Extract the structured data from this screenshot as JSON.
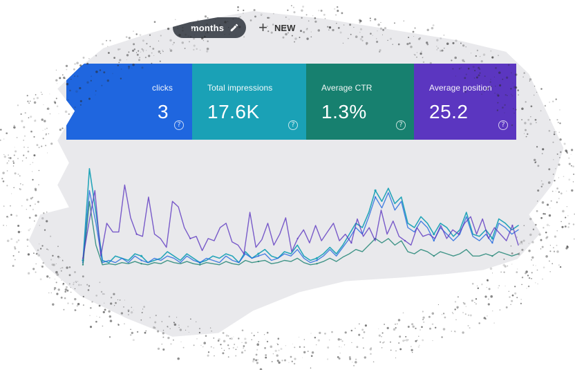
{
  "toolbar": {
    "date_chip_label": "months",
    "edit_icon": "pencil-icon",
    "new_label": "NEW",
    "plus_icon": "plus-icon"
  },
  "metrics": [
    {
      "name": "Total clicks",
      "label": "clicks",
      "value": "3",
      "color": "#1f66df"
    },
    {
      "name": "Total impressions",
      "label": "Total impressions",
      "value": "17.6K",
      "color": "#1aa1b6"
    },
    {
      "name": "Average CTR",
      "label": "Average CTR",
      "value": "1.3%",
      "color": "#17806f"
    },
    {
      "name": "Average position",
      "label": "Average position",
      "value": "25.2",
      "color": "#5b36c0"
    }
  ],
  "icons": {
    "help": "help-icon"
  },
  "chart_data": {
    "type": "line",
    "series": [
      {
        "name": "Average position",
        "color": "#5b36c0",
        "values": [
          8,
          40,
          70,
          10,
          40,
          32,
          32,
          75,
          45,
          30,
          28,
          64,
          30,
          26,
          18,
          60,
          55,
          36,
          26,
          28,
          15,
          26,
          24,
          36,
          40,
          23,
          20,
          12,
          50,
          18,
          25,
          40,
          20,
          30,
          45,
          14,
          26,
          34,
          22,
          38,
          24,
          32,
          40,
          24,
          30,
          22,
          44,
          28,
          36,
          24,
          52,
          30,
          42,
          28,
          24,
          20,
          36,
          28,
          30,
          26,
          38,
          26,
          34,
          30,
          40,
          46,
          30,
          44,
          26,
          36,
          30,
          24,
          38,
          20
        ]
      },
      {
        "name": "Total impressions",
        "color": "#1aa1b6",
        "values": [
          6,
          90,
          50,
          6,
          4,
          10,
          8,
          6,
          12,
          10,
          4,
          6,
          8,
          14,
          10,
          6,
          12,
          8,
          4,
          6,
          10,
          8,
          12,
          10,
          4,
          14,
          8,
          12,
          16,
          10,
          8,
          14,
          12,
          20,
          10,
          6,
          8,
          12,
          18,
          12,
          20,
          30,
          40,
          36,
          50,
          70,
          60,
          72,
          58,
          64,
          40,
          36,
          46,
          40,
          30,
          40,
          36,
          28,
          34,
          50,
          30,
          28,
          34,
          26,
          44,
          40,
          34,
          38
        ]
      },
      {
        "name": "Total clicks",
        "color": "#1f66df",
        "values": [
          4,
          70,
          40,
          4,
          6,
          4,
          8,
          4,
          10,
          6,
          4,
          8,
          6,
          10,
          8,
          4,
          10,
          6,
          4,
          8,
          6,
          4,
          10,
          6,
          4,
          12,
          8,
          10,
          12,
          6,
          8,
          12,
          10,
          16,
          8,
          4,
          6,
          10,
          16,
          10,
          18,
          26,
          36,
          30,
          46,
          64,
          54,
          68,
          52,
          60,
          36,
          32,
          42,
          36,
          24,
          36,
          30,
          24,
          30,
          46,
          28,
          24,
          30,
          22,
          40,
          36,
          30,
          34
        ]
      },
      {
        "name": "Average CTR",
        "color": "#17806f",
        "values": [
          2,
          60,
          20,
          2,
          3,
          2,
          4,
          3,
          5,
          3,
          2,
          4,
          3,
          6,
          4,
          3,
          5,
          3,
          2,
          4,
          3,
          2,
          5,
          3,
          2,
          6,
          4,
          5,
          6,
          3,
          4,
          6,
          5,
          8,
          4,
          2,
          3,
          5,
          8,
          5,
          9,
          12,
          16,
          14,
          20,
          26,
          22,
          26,
          20,
          24,
          14,
          12,
          16,
          14,
          10,
          14,
          12,
          10,
          12,
          16,
          10,
          10,
          12,
          10,
          14,
          12,
          10,
          12
        ]
      }
    ]
  }
}
